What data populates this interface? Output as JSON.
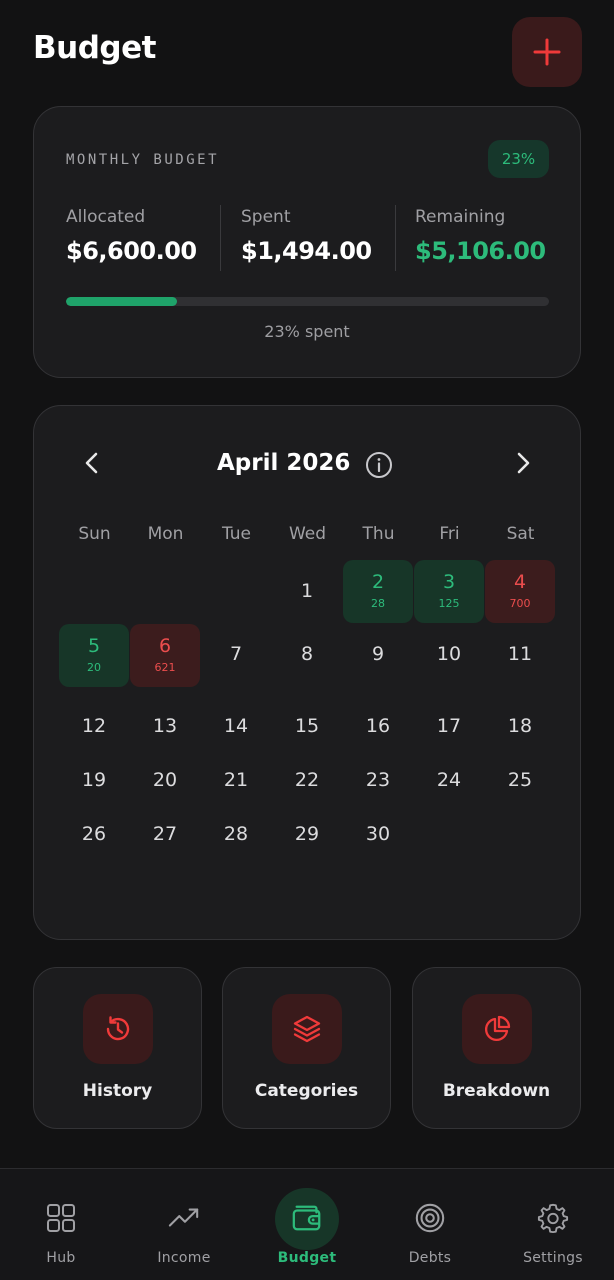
{
  "header": {
    "title": "Budget"
  },
  "budget": {
    "label": "MONTHLY BUDGET",
    "percent_badge": "23%",
    "allocated_label": "Allocated",
    "allocated_value": "$6,600.00",
    "spent_label": "Spent",
    "spent_value": "$1,494.00",
    "remaining_label": "Remaining",
    "remaining_value": "$5,106.00",
    "progress_fraction": 0.23,
    "progress_text": "23% spent"
  },
  "calendar": {
    "month": "April 2026",
    "weekdays": [
      "Sun",
      "Mon",
      "Tue",
      "Wed",
      "Thu",
      "Fri",
      "Sat"
    ],
    "days": [
      {
        "day": "1"
      },
      {
        "day": "2",
        "amount": "28",
        "status": "green"
      },
      {
        "day": "3",
        "amount": "125",
        "status": "green"
      },
      {
        "day": "4",
        "amount": "700",
        "status": "red"
      },
      {
        "day": "5",
        "amount": "20",
        "status": "green"
      },
      {
        "day": "6",
        "amount": "621",
        "status": "red"
      },
      {
        "day": "7"
      },
      {
        "day": "8"
      },
      {
        "day": "9"
      },
      {
        "day": "10"
      },
      {
        "day": "11"
      },
      {
        "day": "12"
      },
      {
        "day": "13"
      },
      {
        "day": "14"
      },
      {
        "day": "15"
      },
      {
        "day": "16"
      },
      {
        "day": "17"
      },
      {
        "day": "18"
      },
      {
        "day": "19"
      },
      {
        "day": "20"
      },
      {
        "day": "21"
      },
      {
        "day": "22"
      },
      {
        "day": "23"
      },
      {
        "day": "24"
      },
      {
        "day": "25"
      },
      {
        "day": "26"
      },
      {
        "day": "27"
      },
      {
        "day": "28"
      },
      {
        "day": "29"
      },
      {
        "day": "30"
      }
    ]
  },
  "actions": [
    {
      "label": "History",
      "icon": "history-icon"
    },
    {
      "label": "Categories",
      "icon": "layers-icon"
    },
    {
      "label": "Breakdown",
      "icon": "pie-chart-icon"
    }
  ],
  "nav": [
    {
      "label": "Hub",
      "icon": "grid-icon"
    },
    {
      "label": "Income",
      "icon": "trend-up-icon"
    },
    {
      "label": "Budget",
      "icon": "wallet-icon",
      "active": true
    },
    {
      "label": "Debts",
      "icon": "target-icon"
    },
    {
      "label": "Settings",
      "icon": "gear-icon"
    }
  ],
  "colors": {
    "accent_green": "#2dbb7b",
    "accent_red": "#ea4d4d",
    "background": "#121213",
    "card": "#1c1c1e"
  }
}
